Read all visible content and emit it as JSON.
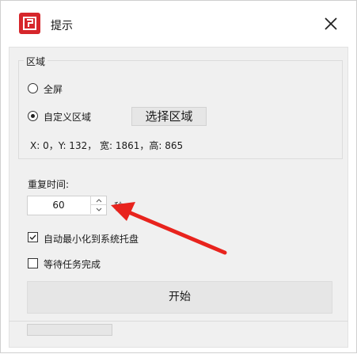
{
  "window": {
    "title": "提示",
    "close_icon": "close-x-icon",
    "app_icon": "app-logo-icon"
  },
  "region": {
    "legend": "区域",
    "options": [
      {
        "label": "全屏",
        "selected": false
      },
      {
        "label": "自定义区域",
        "selected": true
      }
    ],
    "select_button": "选择区域",
    "info": "X: 0，Y: 132， 宽: 1861，高: 865"
  },
  "repeat": {
    "label": "重复时间:",
    "value": "60",
    "unit": "秒"
  },
  "options": {
    "auto_minimize": {
      "label": "自动最小化到系统托盘",
      "checked": true
    },
    "wait_task": {
      "label": "等待任务完成",
      "checked": false
    }
  },
  "start_button": "开始",
  "annotation": {
    "color": "#e8231d"
  }
}
